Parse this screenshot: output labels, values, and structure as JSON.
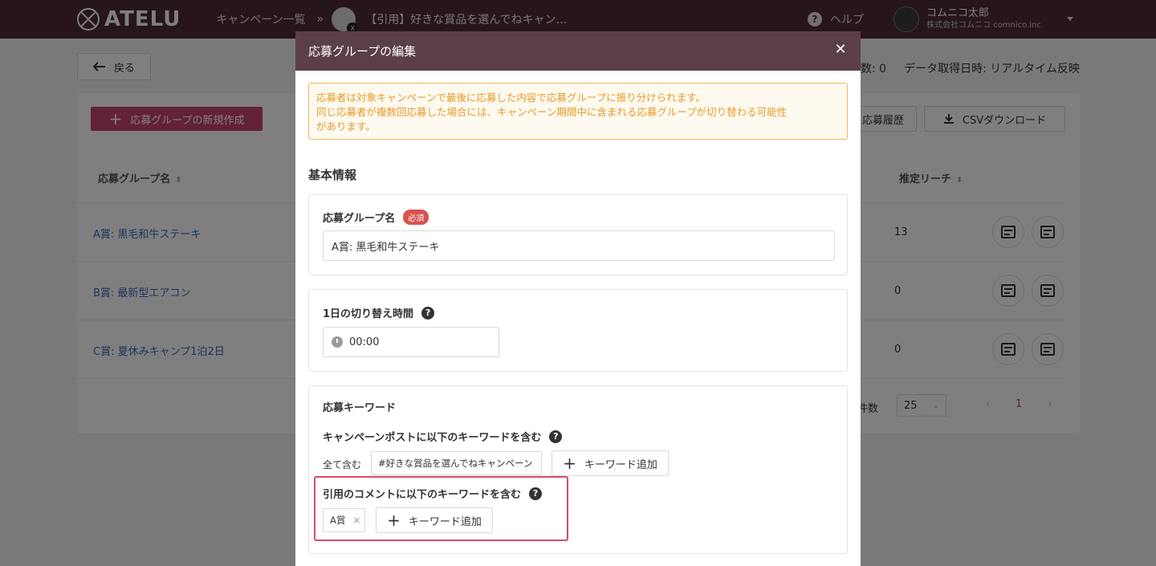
{
  "header": {
    "logo_text": "ATELU",
    "breadcrumb_campaigns": "キャンペーン一覧",
    "breadcrumb_sep": "»",
    "campaign_title": "【引用】好きな賞品を選んでねキャン…",
    "help_label": "ヘルプ",
    "user_name": "コムニコ太郎",
    "user_company": "株式会社コムニコ comnico.inc"
  },
  "page": {
    "back_label": "戻る",
    "stat_entries": "数: 0",
    "stat_fetched": "データ取得日時: リアルタイム反映",
    "new_group_label": "応募グループの新規作成",
    "history_label": "応募履歴",
    "csv_label": "CSVダウンロード",
    "columns": {
      "group_name": "応募グループ名",
      "reach": "推定リーチ"
    },
    "rows": [
      {
        "name": "A賞: 黒毛和牛ステーキ",
        "reach": "13"
      },
      {
        "name": "B賞: 最新型エアコン",
        "reach": "0"
      },
      {
        "name": "C賞: 夏休みキャンプ1泊2日",
        "reach": "0"
      }
    ],
    "page_size_label": "件数",
    "page_size_value": "25",
    "pager_prev": "‹",
    "pager_current": "1",
    "pager_next": "›"
  },
  "modal": {
    "title": "応募グループの編集",
    "notice_line1": "応募者は対象キャンペーンで最後に応募した内容で応募グループに振り分けられます。",
    "notice_line2": "同じ応募者が複数回応募した場合には、キャンペーン期間中に含まれる応募グループが切り替わる可能性",
    "notice_line3": "があります。",
    "section_basic": "基本情報",
    "group_name_label": "応募グループ名",
    "required_badge": "必須",
    "group_name_value": "A賞: 黒毛和牛ステーキ",
    "switch_time_label": "1日の切り替え時間",
    "switch_time_value": "00:00",
    "keyword_section_label": "応募キーワード",
    "post_keyword_label": "キャンペーンポストに以下のキーワードを含む",
    "match_mode": "全て含む",
    "post_keyword_value": "#好きな賞品を選んでねキャンペーン",
    "add_keyword_label": "キーワード追加",
    "quote_keyword_label": "引用のコメントに以下のキーワードを含む",
    "quote_keyword_value": "A賞",
    "remove_symbol": "×"
  },
  "colors": {
    "header_bg": "#4d2d36",
    "modal_header_bg": "#5b3f48",
    "primary_button": "#c7446a",
    "notice_border": "#f2b659",
    "notice_text": "#e79a2a",
    "required_badge": "#d9534f",
    "highlight_border": "#d94a6a",
    "link_text": "#3b6bb8"
  },
  "icons": [
    "logo-icon",
    "back-arrow-icon",
    "help-icon",
    "x-logo-icon",
    "close-icon",
    "plus-icon",
    "download-icon",
    "sort-icon",
    "edit-icon",
    "web-icon",
    "clock-icon",
    "question-icon",
    "chevron-down-icon"
  ]
}
